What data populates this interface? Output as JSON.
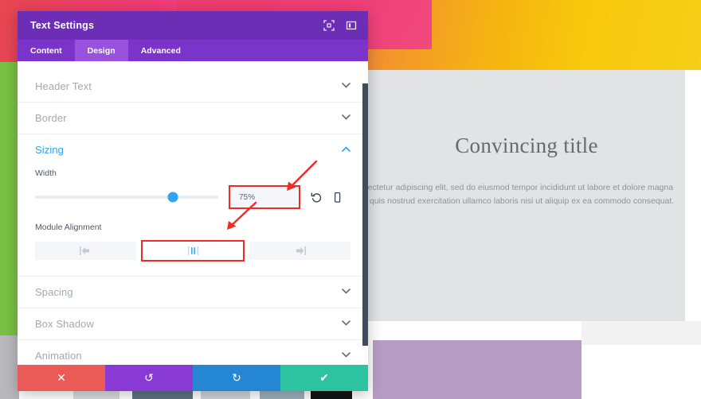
{
  "modal": {
    "title": "Text Settings",
    "titlebar_icons": [
      {
        "name": "expand-icon",
        "glyph": "expand"
      },
      {
        "name": "layout-split-icon",
        "glyph": "layout"
      }
    ],
    "tabs": [
      {
        "label": "Content",
        "active": false
      },
      {
        "label": "Design",
        "active": true
      },
      {
        "label": "Advanced",
        "active": false
      }
    ],
    "sections": [
      {
        "label": "Header Text",
        "open": false
      },
      {
        "label": "Border",
        "open": false
      },
      {
        "label": "Sizing",
        "open": true
      },
      {
        "label": "Spacing",
        "open": false
      },
      {
        "label": "Box Shadow",
        "open": false
      },
      {
        "label": "Animation",
        "open": false
      }
    ],
    "sizing": {
      "width_label": "Width",
      "width_value": "75%",
      "width_percent": 75,
      "reset_icon": "undo-reset-icon",
      "responsive_icon": "mobile-device-icon",
      "module_alignment_label": "Module Alignment",
      "alignment_options": [
        {
          "name": "align-left",
          "selected": false
        },
        {
          "name": "align-center",
          "selected": true
        },
        {
          "name": "align-right",
          "selected": false
        }
      ]
    },
    "footer": [
      {
        "name": "cancel-button",
        "glyph": "✕",
        "color": "#ea5a56"
      },
      {
        "name": "undo-button",
        "glyph": "↺",
        "color": "#8a3ad4"
      },
      {
        "name": "redo-button",
        "glyph": "↻",
        "color": "#2586d4"
      },
      {
        "name": "save-button",
        "glyph": "✔",
        "color": "#2dc3a0"
      }
    ]
  },
  "page": {
    "title": "Convincing title",
    "body": "Lorem ipsum dolor sit amet, consectetur adipiscing elit, sed do eiusmod tempor incididunt ut labore et dolore magna aliqua. Ut enim ad minim veniam, quis nostrud exercitation ullamco laboris nisi ut aliquip ex ea commodo consequat."
  },
  "colors": {
    "accent_blue": "#2ea3f2",
    "modal_purple": "#6b2eb5",
    "tab_purple": "#7b34c9",
    "tab_active_purple": "#9a52de",
    "annotation_red": "#ee2b24"
  }
}
